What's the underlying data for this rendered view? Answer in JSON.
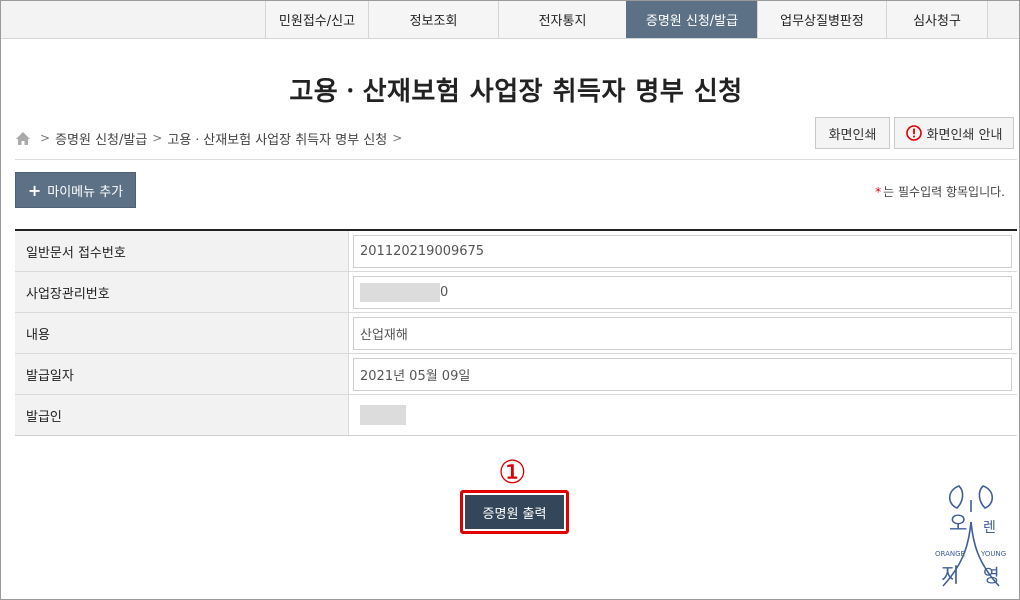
{
  "nav": {
    "tabs": [
      {
        "label": "민원접수/신고",
        "active": false
      },
      {
        "label": "정보조회",
        "active": false
      },
      {
        "label": "전자통지",
        "active": false
      },
      {
        "label": "증명원 신청/발급",
        "active": true
      },
      {
        "label": "업무상질병판정",
        "active": false
      },
      {
        "label": "심사청구",
        "active": false
      }
    ]
  },
  "page_title": "고용ㆍ산재보험 사업장 취득자 명부 신청",
  "breadcrumb": {
    "home_icon": "home-icon",
    "items": [
      "증명원 신청/발급",
      "고용ㆍ산재보험 사업장 취득자 명부 신청"
    ],
    "separator": ">"
  },
  "buttons": {
    "print": "화면인쇄",
    "print_guide": "화면인쇄 안내",
    "my_menu_plus": "+",
    "my_menu": "마이메뉴 추가",
    "issue": "증명원 출력"
  },
  "required_note": {
    "star": "*",
    "text": "는 필수입력 항목입니다."
  },
  "form": {
    "rows": [
      {
        "label": "일반문서 접수번호",
        "value": "201120219009675"
      },
      {
        "label": "사업장관리번호",
        "value": "0"
      },
      {
        "label": "내용",
        "value": "산업재해"
      },
      {
        "label": "발급일자",
        "value": "2021년 05월 09일"
      },
      {
        "label": "발급인",
        "value": ""
      }
    ]
  },
  "step_marker": "①",
  "watermark": {
    "top_text": "오 렌",
    "mid_left": "ORANGE",
    "mid_right": "YOUNG",
    "bottom_text": "지 영"
  },
  "colors": {
    "nav_active": "#5d7186",
    "issue_button": "#34465a",
    "highlight_red": "#e00000",
    "watermark": "#3f5f99"
  }
}
